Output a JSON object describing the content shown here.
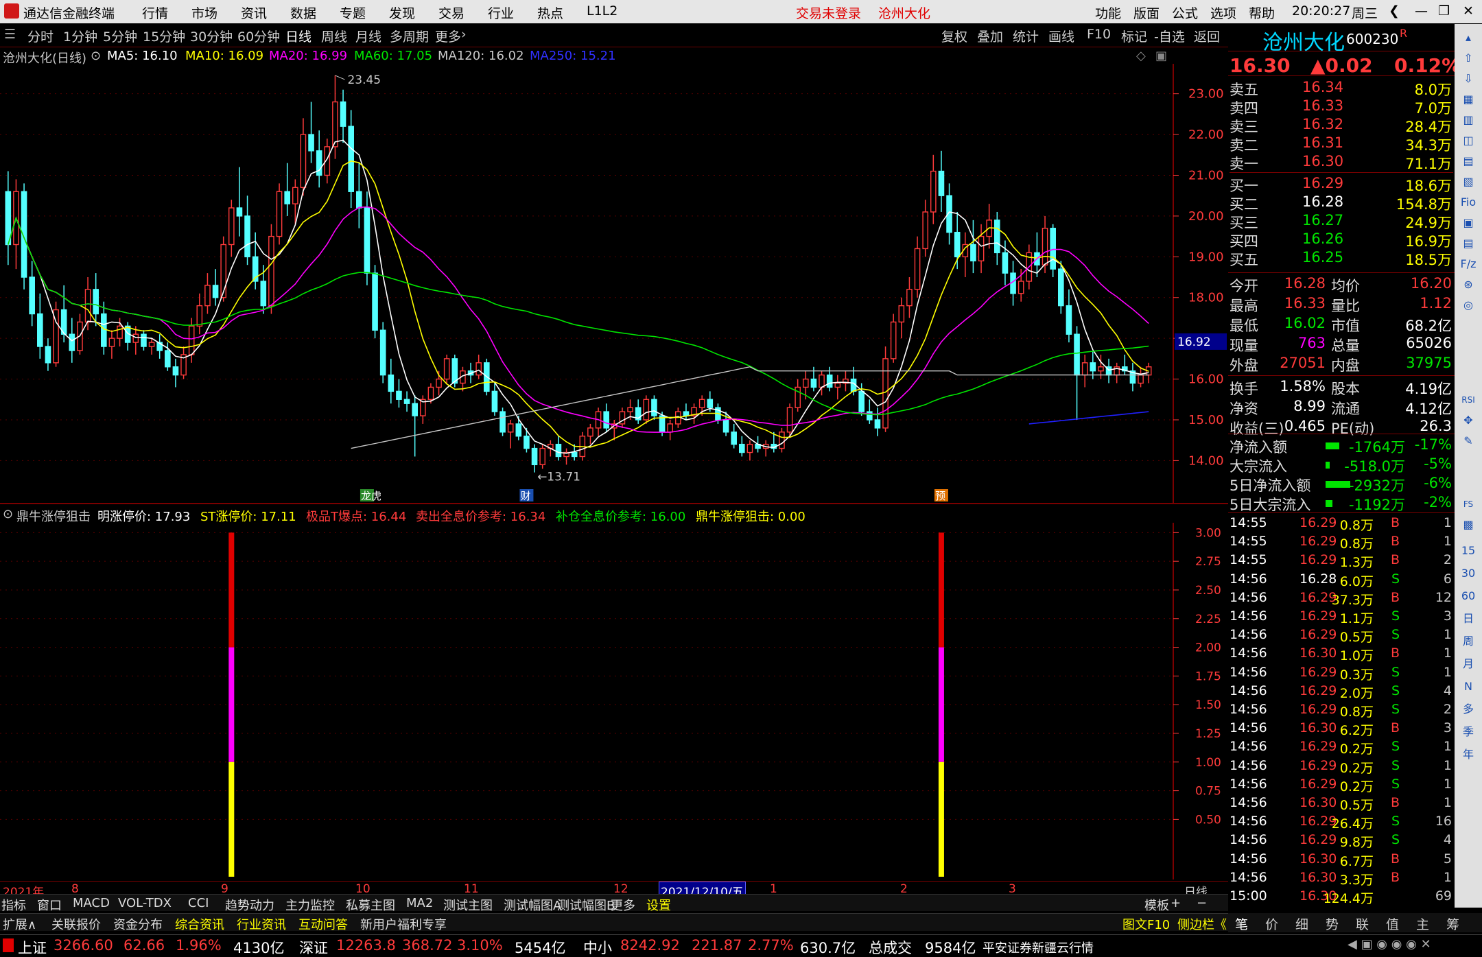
{
  "title": {
    "app": "通达信金融终端",
    "menus": [
      "行情",
      "市场",
      "资讯",
      "数据",
      "专题",
      "发现",
      "交易",
      "行业",
      "热点",
      "L1L2"
    ],
    "notice": "交易未登录",
    "stock": "沧州大化",
    "right_menus": [
      "功能",
      "版面",
      "公式",
      "选项",
      "帮助"
    ],
    "time": "20:20:27",
    "weekday": "周三"
  },
  "toolbar": {
    "periods": [
      "分时",
      "1分钟",
      "5分钟",
      "15分钟",
      "30分钟",
      "60分钟",
      "日线",
      "周线",
      "月线",
      "多周期",
      "更多"
    ],
    "active": "日线",
    "right": [
      "复权",
      "叠加",
      "统计",
      "画线",
      "F10",
      "标记",
      "-自选",
      "返回"
    ]
  },
  "ma": {
    "name": "沧州大化(日线)",
    "ma5": "MA5: 16.10",
    "ma10": "MA10: 16.09",
    "ma20": "MA20: 16.99",
    "ma60": "MA60: 17.05",
    "ma120": "MA120: 16.02",
    "ma250": "MA250: 15.21"
  },
  "price_axis": [
    "23.00",
    "22.00",
    "21.00",
    "20.00",
    "19.00",
    "18.00",
    "17.00",
    "16.00",
    "15.00",
    "14.00"
  ],
  "price_tag": "16.92",
  "annotations": {
    "high": "23.45",
    "low": "13.71",
    "mark1": "龙虎",
    "mark2": "财",
    "mark3": "预"
  },
  "indicator": {
    "name": "鼎牛涨停狙击",
    "l1": "明涨停价: 17.93",
    "l2": "ST涨停价: 17.11",
    "l3": "极品T爆点: 16.44",
    "l4": "卖出全息价参考: 16.34",
    "l5": "补仓全息价参考: 16.00",
    "l6": "鼎牛涨停狙击: 0.00"
  },
  "ind_axis": [
    "3.00",
    "2.75",
    "2.50",
    "2.25",
    "2.00",
    "1.75",
    "1.50",
    "1.25",
    "1.00",
    "0.75",
    "0.50"
  ],
  "date_axis": {
    "labels": [
      "2021年",
      "8",
      "9",
      "10",
      "11",
      "12",
      "2021/12/10/五",
      "1",
      "2",
      "3"
    ],
    "period": "日线"
  },
  "bottom_tabs1": [
    "指标",
    "窗口",
    "MACD",
    "VOL-TDX",
    "CCI",
    "趋势动力",
    "主力监控",
    "私募主图",
    "MA2",
    "测试主图",
    "测试幅图A",
    "测试幅图B",
    "更多",
    "设置"
  ],
  "bottom_tabs1_right": [
    "模板",
    "+",
    "−"
  ],
  "bottom_tabs2": [
    "扩展∧",
    "关联报价",
    "资金分布",
    "综合资讯",
    "行业资讯",
    "互动问答",
    "新用户福利专享"
  ],
  "bottom_tabs2_right": [
    "图文F10",
    "侧边栏《"
  ],
  "rp_tabs": [
    "笔",
    "价",
    "细",
    "势",
    "联",
    "值",
    "主",
    "筹"
  ],
  "quote": {
    "name": "沧州大化",
    "code": "600230",
    "flag": "R",
    "price": "16.30",
    "change": "▲0.02",
    "pct": "0.12%"
  },
  "asks": [
    {
      "l": "卖五",
      "p": "16.34",
      "v": "8.0万"
    },
    {
      "l": "卖四",
      "p": "16.33",
      "v": "7.0万"
    },
    {
      "l": "卖三",
      "p": "16.32",
      "v": "28.4万"
    },
    {
      "l": "卖二",
      "p": "16.31",
      "v": "34.3万"
    },
    {
      "l": "卖一",
      "p": "16.30",
      "v": "71.1万"
    }
  ],
  "bids": [
    {
      "l": "买一",
      "p": "16.29",
      "v": "18.6万"
    },
    {
      "l": "买二",
      "p": "16.28",
      "v": "154.8万"
    },
    {
      "l": "买三",
      "p": "16.27",
      "v": "24.9万"
    },
    {
      "l": "买四",
      "p": "16.26",
      "v": "16.9万"
    },
    {
      "l": "买五",
      "p": "16.25",
      "v": "18.5万"
    }
  ],
  "stats": [
    {
      "a": "今开",
      "av": "16.28",
      "b": "均价",
      "bv": "16.20"
    },
    {
      "a": "最高",
      "av": "16.33",
      "b": "量比",
      "bv": "1.12"
    },
    {
      "a": "最低",
      "av": "16.02",
      "b": "市值",
      "bv": "68.2亿"
    },
    {
      "a": "现量",
      "av": "763",
      "b": "总量",
      "bv": "65026"
    },
    {
      "a": "外盘",
      "av": "27051",
      "b": "内盘",
      "bv": "37975"
    }
  ],
  "stats2": [
    {
      "a": "换手",
      "av": "1.58%",
      "b": "股本",
      "bv": "4.19亿"
    },
    {
      "a": "净资",
      "av": "8.99",
      "b": "流通",
      "bv": "4.12亿"
    },
    {
      "a": "收益(三)",
      "av": "0.465",
      "b": "PE(动)",
      "bv": "26.3"
    }
  ],
  "flows": [
    {
      "l": "净流入额",
      "v": "-1764万",
      "p": "-17%"
    },
    {
      "l": "大宗流入",
      "v": "-518.0万",
      "p": "-5%"
    },
    {
      "l": "5日净流入额",
      "v": "-2932万",
      "p": "-6%"
    },
    {
      "l": "5日大宗流入",
      "v": "-1192万",
      "p": "-2%"
    }
  ],
  "ticks": [
    {
      "t": "14:55",
      "p": "16.29",
      "v": "0.8万",
      "d": "B",
      "n": "1"
    },
    {
      "t": "14:55",
      "p": "16.29",
      "v": "0.8万",
      "d": "B",
      "n": "1"
    },
    {
      "t": "14:55",
      "p": "16.29",
      "v": "1.3万",
      "d": "B",
      "n": "2"
    },
    {
      "t": "14:56",
      "p": "16.28",
      "v": "6.0万",
      "d": "S",
      "n": "6"
    },
    {
      "t": "14:56",
      "p": "16.29",
      "v": "37.3万",
      "d": "B",
      "n": "12"
    },
    {
      "t": "14:56",
      "p": "16.29",
      "v": "1.1万",
      "d": "S",
      "n": "3"
    },
    {
      "t": "14:56",
      "p": "16.29",
      "v": "0.5万",
      "d": "S",
      "n": "1"
    },
    {
      "t": "14:56",
      "p": "16.30",
      "v": "1.0万",
      "d": "B",
      "n": "1"
    },
    {
      "t": "14:56",
      "p": "16.29",
      "v": "0.3万",
      "d": "S",
      "n": "1"
    },
    {
      "t": "14:56",
      "p": "16.29",
      "v": "2.0万",
      "d": "S",
      "n": "4"
    },
    {
      "t": "14:56",
      "p": "16.29",
      "v": "0.8万",
      "d": "S",
      "n": "2"
    },
    {
      "t": "14:56",
      "p": "16.30",
      "v": "6.2万",
      "d": "B",
      "n": "3"
    },
    {
      "t": "14:56",
      "p": "16.29",
      "v": "0.2万",
      "d": "S",
      "n": "1"
    },
    {
      "t": "14:56",
      "p": "16.29",
      "v": "0.2万",
      "d": "S",
      "n": "1"
    },
    {
      "t": "14:56",
      "p": "16.29",
      "v": "0.2万",
      "d": "S",
      "n": "1"
    },
    {
      "t": "14:56",
      "p": "16.30",
      "v": "0.5万",
      "d": "B",
      "n": "1"
    },
    {
      "t": "14:56",
      "p": "16.29",
      "v": "26.4万",
      "d": "S",
      "n": "16"
    },
    {
      "t": "14:56",
      "p": "16.29",
      "v": "9.8万",
      "d": "S",
      "n": "4"
    },
    {
      "t": "14:56",
      "p": "16.30",
      "v": "6.7万",
      "d": "B",
      "n": "5"
    },
    {
      "t": "14:56",
      "p": "16.30",
      "v": "3.3万",
      "d": "B",
      "n": "1"
    },
    {
      "t": "15:00",
      "p": "16.30",
      "v": "124.4万",
      "d": "",
      "n": "69"
    }
  ],
  "sidebar_labels": [
    "RSI",
    "FS",
    "15",
    "30",
    "60",
    "日",
    "周",
    "月",
    "N",
    "多",
    "季",
    "年"
  ],
  "status": {
    "sh": "上证",
    "sh_v": "3266.60",
    "sh_c": "62.66",
    "sh_p": "1.96%",
    "sh_a": "4130亿",
    "sz": "深证",
    "sz_v": "12263.8",
    "sz_c": "368.72",
    "sz_p": "3.10%",
    "sz_a": "5454亿",
    "zx": "中小",
    "zx_v": "8242.92",
    "zx_c": "221.87",
    "zx_p": "2.77%",
    "zx_a": "630.7亿",
    "total": "总成交",
    "total_v": "9584亿",
    "broker": "平安证券新疆云行情"
  },
  "colors": {
    "up": "#ff3b3b",
    "down": "#54ffff",
    "ma5": "#ffffff",
    "ma10": "#ffff00",
    "ma20": "#ff00ff",
    "ma60": "#00e600",
    "ma120": "#c8c8c8",
    "ma250": "#2020ff"
  },
  "ohlc": [
    [
      20.6,
      21.1,
      18.8,
      19.3
    ],
    [
      19.3,
      20.9,
      18.7,
      20.6
    ],
    [
      20.6,
      20.8,
      18.2,
      18.5
    ],
    [
      18.5,
      18.9,
      17.3,
      17.6
    ],
    [
      17.6,
      18.1,
      16.5,
      16.8
    ],
    [
      16.8,
      17.0,
      16.2,
      16.4
    ],
    [
      16.4,
      17.9,
      16.3,
      17.7
    ],
    [
      17.7,
      18.3,
      16.9,
      17.1
    ],
    [
      17.1,
      17.5,
      16.4,
      16.7
    ],
    [
      16.7,
      17.6,
      16.6,
      17.4
    ],
    [
      17.4,
      18.5,
      17.2,
      18.2
    ],
    [
      18.2,
      18.6,
      17.3,
      17.6
    ],
    [
      17.6,
      17.9,
      16.6,
      16.8
    ],
    [
      16.8,
      17.2,
      16.5,
      17.0
    ],
    [
      17.0,
      17.5,
      16.8,
      17.3
    ],
    [
      17.3,
      17.4,
      16.7,
      16.9
    ],
    [
      16.9,
      17.3,
      16.6,
      17.1
    ],
    [
      17.1,
      17.2,
      16.7,
      16.8
    ],
    [
      16.8,
      17.0,
      16.6,
      16.9
    ],
    [
      16.9,
      17.1,
      16.5,
      16.7
    ],
    [
      16.7,
      16.9,
      16.2,
      16.3
    ],
    [
      16.3,
      16.5,
      15.8,
      16.1
    ],
    [
      16.1,
      16.8,
      16.0,
      16.6
    ],
    [
      16.6,
      17.5,
      16.4,
      17.3
    ],
    [
      17.3,
      18.1,
      17.1,
      17.8
    ],
    [
      17.8,
      18.6,
      17.6,
      18.3
    ],
    [
      18.3,
      18.7,
      17.8,
      18.0
    ],
    [
      18.0,
      19.5,
      17.9,
      19.3
    ],
    [
      19.3,
      20.4,
      19.0,
      20.2
    ],
    [
      20.2,
      21.2,
      19.5,
      20.0
    ],
    [
      20.0,
      20.5,
      18.8,
      19.0
    ],
    [
      19.0,
      19.6,
      18.2,
      18.4
    ],
    [
      18.4,
      18.8,
      17.6,
      17.8
    ],
    [
      17.8,
      19.8,
      17.6,
      19.5
    ],
    [
      19.5,
      20.8,
      19.3,
      20.6
    ],
    [
      20.6,
      21.3,
      20.0,
      20.3
    ],
    [
      20.3,
      20.9,
      19.8,
      20.7
    ],
    [
      20.7,
      22.4,
      20.5,
      22.0
    ],
    [
      22.0,
      22.8,
      21.3,
      21.6
    ],
    [
      21.6,
      22.1,
      20.7,
      21.0
    ],
    [
      21.0,
      21.9,
      20.8,
      21.7
    ],
    [
      21.7,
      23.45,
      21.4,
      22.8
    ],
    [
      22.8,
      23.1,
      21.8,
      22.2
    ],
    [
      22.2,
      22.6,
      20.2,
      20.6
    ],
    [
      20.6,
      21.3,
      19.7,
      20.2
    ],
    [
      20.2,
      20.6,
      18.3,
      18.6
    ],
    [
      18.6,
      18.8,
      17.0,
      17.2
    ],
    [
      17.2,
      17.4,
      15.9,
      16.1
    ],
    [
      16.1,
      16.5,
      15.4,
      15.7
    ],
    [
      15.7,
      16.0,
      15.3,
      15.5
    ],
    [
      15.5,
      15.7,
      15.2,
      15.4
    ],
    [
      15.4,
      15.6,
      14.1,
      15.1
    ],
    [
      15.1,
      15.6,
      14.9,
      15.5
    ],
    [
      15.5,
      15.9,
      15.4,
      15.8
    ],
    [
      15.8,
      16.2,
      15.6,
      16.0
    ],
    [
      16.0,
      16.6,
      15.9,
      16.5
    ],
    [
      16.5,
      16.6,
      15.8,
      15.9
    ],
    [
      15.9,
      16.3,
      15.7,
      16.2
    ],
    [
      16.2,
      16.4,
      15.9,
      16.1
    ],
    [
      16.1,
      16.6,
      16.0,
      16.4
    ],
    [
      16.4,
      16.5,
      15.6,
      15.7
    ],
    [
      15.7,
      15.9,
      15.1,
      15.2
    ],
    [
      15.2,
      15.3,
      14.6,
      14.7
    ],
    [
      14.7,
      15.0,
      14.3,
      14.9
    ],
    [
      14.9,
      15.1,
      14.5,
      14.6
    ],
    [
      14.6,
      14.8,
      14.2,
      14.3
    ],
    [
      14.3,
      14.4,
      13.71,
      13.9
    ],
    [
      13.9,
      14.4,
      13.8,
      14.3
    ],
    [
      14.3,
      14.5,
      14.1,
      14.4
    ],
    [
      14.4,
      14.6,
      14.0,
      14.1
    ],
    [
      14.1,
      14.3,
      13.9,
      14.2
    ],
    [
      14.2,
      14.4,
      14.0,
      14.1
    ],
    [
      14.1,
      14.7,
      14.0,
      14.6
    ],
    [
      14.6,
      14.9,
      14.4,
      14.8
    ],
    [
      14.8,
      15.3,
      14.6,
      15.2
    ],
    [
      15.2,
      15.4,
      14.7,
      14.8
    ],
    [
      14.8,
      15.0,
      14.5,
      14.9
    ],
    [
      14.9,
      15.3,
      14.8,
      15.2
    ],
    [
      15.2,
      15.5,
      15.0,
      15.3
    ],
    [
      15.3,
      15.5,
      14.9,
      15.0
    ],
    [
      15.0,
      15.6,
      14.9,
      15.5
    ],
    [
      15.5,
      15.6,
      15.0,
      15.1
    ],
    [
      15.1,
      15.2,
      14.6,
      14.7
    ],
    [
      14.7,
      15.0,
      14.5,
      14.9
    ],
    [
      14.9,
      15.3,
      14.8,
      15.2
    ],
    [
      15.2,
      15.4,
      15.0,
      15.1
    ],
    [
      15.1,
      15.4,
      14.9,
      15.3
    ],
    [
      15.3,
      15.6,
      15.1,
      15.5
    ],
    [
      15.5,
      15.7,
      15.2,
      15.3
    ],
    [
      15.3,
      15.4,
      14.9,
      15.0
    ],
    [
      15.0,
      15.2,
      14.6,
      14.7
    ],
    [
      14.7,
      14.9,
      14.3,
      14.4
    ],
    [
      14.4,
      14.6,
      14.1,
      14.2
    ],
    [
      14.2,
      14.5,
      14.0,
      14.4
    ],
    [
      14.4,
      14.6,
      14.2,
      14.3
    ],
    [
      14.3,
      14.5,
      14.1,
      14.4
    ],
    [
      14.4,
      14.7,
      14.2,
      14.3
    ],
    [
      14.3,
      14.8,
      14.2,
      14.7
    ],
    [
      14.7,
      15.4,
      14.6,
      15.3
    ],
    [
      15.3,
      16.0,
      15.2,
      15.8
    ],
    [
      15.8,
      16.2,
      15.5,
      16.0
    ],
    [
      16.0,
      16.3,
      15.7,
      15.8
    ],
    [
      15.8,
      16.2,
      15.6,
      16.1
    ],
    [
      16.1,
      16.3,
      15.7,
      15.8
    ],
    [
      15.8,
      16.1,
      15.5,
      15.9
    ],
    [
      15.9,
      16.2,
      15.7,
      16.0
    ],
    [
      16.0,
      16.3,
      15.6,
      15.7
    ],
    [
      15.7,
      15.9,
      15.1,
      15.2
    ],
    [
      15.2,
      15.5,
      14.9,
      15.0
    ],
    [
      15.0,
      15.3,
      14.6,
      14.8
    ],
    [
      14.8,
      16.8,
      14.7,
      16.5
    ],
    [
      16.5,
      17.6,
      16.4,
      17.4
    ],
    [
      17.4,
      18.0,
      17.0,
      17.8
    ],
    [
      17.8,
      18.5,
      17.5,
      18.2
    ],
    [
      18.2,
      19.5,
      18.0,
      19.2
    ],
    [
      19.2,
      20.4,
      19.0,
      20.1
    ],
    [
      20.1,
      21.5,
      19.8,
      21.1
    ],
    [
      21.1,
      21.6,
      20.1,
      20.5
    ],
    [
      20.5,
      20.8,
      19.3,
      19.6
    ],
    [
      19.6,
      20.1,
      18.7,
      19.0
    ],
    [
      19.0,
      19.6,
      18.5,
      19.3
    ],
    [
      19.3,
      19.9,
      18.6,
      18.9
    ],
    [
      18.9,
      19.8,
      18.6,
      19.5
    ],
    [
      19.5,
      20.3,
      19.2,
      19.9
    ],
    [
      19.9,
      20.1,
      18.8,
      19.1
    ],
    [
      19.1,
      19.4,
      18.3,
      18.6
    ],
    [
      18.6,
      18.9,
      17.8,
      18.1
    ],
    [
      18.1,
      18.7,
      17.9,
      18.4
    ],
    [
      18.4,
      19.3,
      18.2,
      19.1
    ],
    [
      19.1,
      19.6,
      18.5,
      18.8
    ],
    [
      18.8,
      20.0,
      18.6,
      19.7
    ],
    [
      19.7,
      19.8,
      18.5,
      18.7
    ],
    [
      18.7,
      18.9,
      17.6,
      17.8
    ],
    [
      17.8,
      18.2,
      16.9,
      17.1
    ],
    [
      17.1,
      17.3,
      15.0,
      16.1
    ],
    [
      16.1,
      16.6,
      15.8,
      16.4
    ],
    [
      16.4,
      16.7,
      16.0,
      16.2
    ],
    [
      16.2,
      16.6,
      16.0,
      16.3
    ],
    [
      16.3,
      16.5,
      15.9,
      16.1
    ],
    [
      16.1,
      16.4,
      15.9,
      16.3
    ],
    [
      16.3,
      16.6,
      16.1,
      16.2
    ],
    [
      16.2,
      16.4,
      15.7,
      15.9
    ],
    [
      15.9,
      16.3,
      15.8,
      16.1
    ],
    [
      16.1,
      16.4,
      15.9,
      16.3
    ]
  ],
  "ind_bars": [
    {
      "idx": 28,
      "red": 3.0,
      "mag": 2.0,
      "yel": 1.0
    },
    {
      "idx": 117,
      "red": 3.0,
      "mag": 2.0,
      "yel": 1.0
    }
  ]
}
